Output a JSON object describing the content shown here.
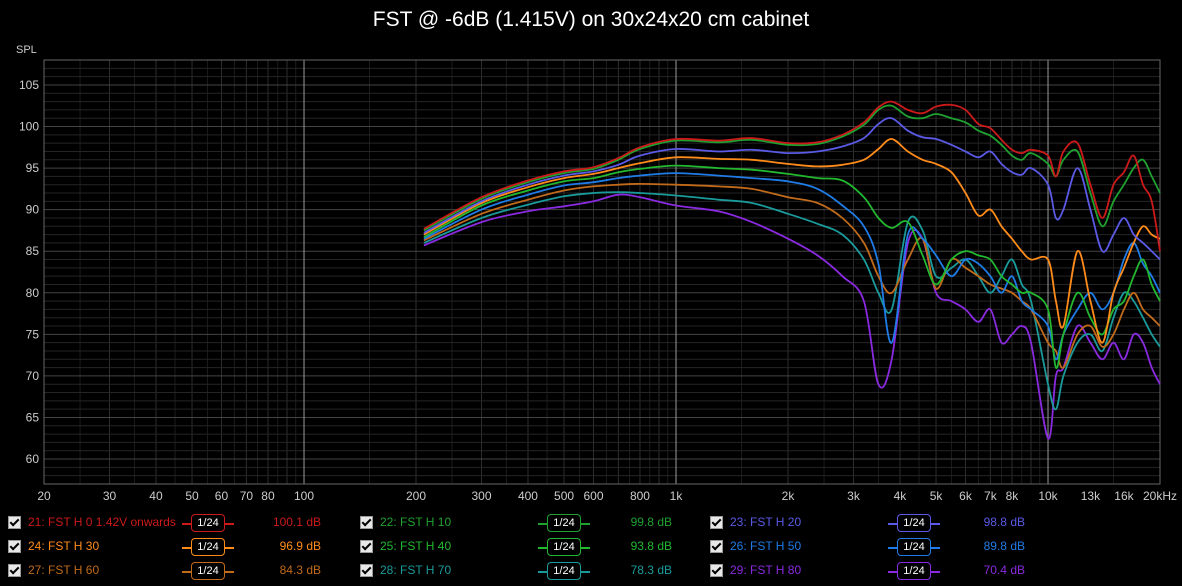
{
  "title": "FST @ -6dB (1.415V) on 30x24x20 cm cabinet",
  "smoothing_label": "1/24",
  "chart_data": {
    "type": "line",
    "title": "FST @ -6dB (1.415V) on 30x24x20 cm cabinet",
    "xlabel": "",
    "ylabel": "SPL",
    "x_scale": "log",
    "xlim": [
      20,
      20000
    ],
    "ylim": [
      57,
      108
    ],
    "grid": true,
    "x_ticks": [
      {
        "v": 20,
        "label": "20"
      },
      {
        "v": 30,
        "label": "30"
      },
      {
        "v": 40,
        "label": "40"
      },
      {
        "v": 50,
        "label": "50"
      },
      {
        "v": 60,
        "label": "60"
      },
      {
        "v": 70,
        "label": "70"
      },
      {
        "v": 80,
        "label": "80"
      },
      {
        "v": 100,
        "label": "100"
      },
      {
        "v": 200,
        "label": "200"
      },
      {
        "v": 300,
        "label": "300"
      },
      {
        "v": 400,
        "label": "400"
      },
      {
        "v": 500,
        "label": "500"
      },
      {
        "v": 600,
        "label": "600"
      },
      {
        "v": 800,
        "label": "800"
      },
      {
        "v": 1000,
        "label": "1k"
      },
      {
        "v": 2000,
        "label": "2k"
      },
      {
        "v": 3000,
        "label": "3k"
      },
      {
        "v": 4000,
        "label": "4k"
      },
      {
        "v": 5000,
        "label": "5k"
      },
      {
        "v": 6000,
        "label": "6k"
      },
      {
        "v": 7000,
        "label": "7k"
      },
      {
        "v": 8000,
        "label": "8k"
      },
      {
        "v": 10000,
        "label": "10k"
      },
      {
        "v": 13000,
        "label": "13k"
      },
      {
        "v": 16000,
        "label": "16k"
      },
      {
        "v": 20000,
        "label": "20kHz"
      }
    ],
    "y_ticks": [
      60,
      65,
      70,
      75,
      80,
      85,
      90,
      95,
      100,
      105
    ],
    "legend_placement": "bottom",
    "x": [
      210,
      300,
      400,
      500,
      600,
      700,
      800,
      1000,
      1300,
      1600,
      2000,
      2400,
      2800,
      3200,
      3500,
      3800,
      4200,
      4600,
      5000,
      5500,
      6000,
      6500,
      7000,
      7500,
      8000,
      8500,
      9000,
      10000,
      10500,
      11000,
      12000,
      13000,
      14000,
      15000,
      16000,
      17000,
      18000,
      19000,
      20000
    ],
    "series": [
      {
        "name": "21: FST H 0 1.42V onwards",
        "color": "#cc1a1a",
        "value_label": "100.1 dB",
        "values": [
          87.7,
          91.5,
          93.5,
          94.6,
          95.1,
          96.2,
          97.5,
          98.5,
          98.3,
          98.6,
          98.0,
          98.1,
          99.0,
          100.5,
          102.3,
          103.0,
          102.0,
          101.6,
          102.4,
          102.6,
          102.0,
          100.3,
          99.8,
          98.4,
          97.2,
          96.8,
          97.2,
          96.5,
          94.0,
          97.0,
          98.0,
          93.0,
          89.0,
          93.0,
          94.5,
          96.5,
          93.0,
          91.0,
          85.0
        ]
      },
      {
        "name": "22: FST H 10",
        "color": "#1fa12f",
        "value_label": "99.8 dB",
        "values": [
          87.5,
          91.3,
          93.3,
          94.4,
          94.9,
          96.0,
          97.3,
          98.3,
          98.1,
          98.4,
          97.8,
          97.9,
          98.8,
          100.2,
          102.0,
          102.5,
          101.2,
          101.0,
          101.5,
          101.0,
          100.5,
          99.5,
          98.9,
          97.8,
          96.5,
          96.0,
          96.8,
          95.5,
          94.0,
          96.0,
          97.0,
          92.0,
          88.0,
          91.0,
          93.0,
          95.0,
          96.0,
          94.0,
          92.0
        ]
      },
      {
        "name": "23: FST H 20",
        "color": "#5a5ae6",
        "value_label": "98.8 dB",
        "values": [
          87.2,
          91.0,
          93.0,
          94.1,
          94.6,
          95.4,
          96.5,
          97.3,
          97.0,
          97.2,
          96.8,
          97.0,
          97.6,
          98.6,
          100.3,
          101.0,
          99.5,
          98.7,
          98.5,
          97.8,
          97.0,
          96.3,
          97.0,
          95.5,
          94.5,
          94.2,
          95.0,
          93.0,
          89.0,
          90.0,
          95.0,
          90.0,
          85.0,
          87.0,
          89.0,
          87.0,
          86.0,
          85.0,
          84.0
        ]
      },
      {
        "name": "24: FST H 30",
        "color": "#ff8c1a",
        "value_label": "96.9 dB",
        "values": [
          87.0,
          90.8,
          92.7,
          93.8,
          94.3,
          95.0,
          95.6,
          96.3,
          96.1,
          96.0,
          95.5,
          95.2,
          95.4,
          96.0,
          97.3,
          98.5,
          97.0,
          96.0,
          95.5,
          94.5,
          92.0,
          89.3,
          90.0,
          88.0,
          86.5,
          85.0,
          84.0,
          84.0,
          79.0,
          76.0,
          85.0,
          79.0,
          74.0,
          80.0,
          83.0,
          86.0,
          88.0,
          87.0,
          86.5
        ]
      },
      {
        "name": "25: FST H 40",
        "color": "#22b82f",
        "value_label": "93.8 dB",
        "values": [
          86.7,
          90.5,
          92.3,
          93.4,
          93.8,
          94.5,
          94.9,
          95.3,
          95.0,
          94.8,
          94.3,
          93.8,
          93.5,
          91.5,
          89.0,
          87.8,
          88.5,
          84.5,
          81.0,
          84.0,
          85.0,
          84.5,
          84.0,
          82.0,
          81.0,
          80.0,
          80.0,
          78.0,
          71.0,
          75.0,
          80.0,
          77.0,
          75.0,
          78.0,
          79.0,
          82.0,
          84.0,
          81.0,
          79.0
        ]
      },
      {
        "name": "26: FST H 50",
        "color": "#1f7be6",
        "value_label": "89.8 dB",
        "values": [
          86.5,
          90.0,
          91.8,
          92.9,
          93.3,
          93.8,
          94.1,
          94.4,
          94.1,
          93.8,
          93.4,
          92.5,
          90.5,
          88.0,
          83.5,
          74.0,
          87.0,
          86.5,
          84.5,
          82.0,
          84.0,
          83.5,
          82.0,
          80.0,
          82.0,
          79.0,
          78.0,
          76.0,
          72.0,
          75.0,
          78.0,
          80.0,
          78.0,
          80.0,
          84.0,
          86.0,
          83.5,
          82.0,
          80.0
        ]
      },
      {
        "name": "27: FST H 60",
        "color": "#c06a1a",
        "value_label": "84.3 dB",
        "values": [
          86.3,
          89.5,
          91.2,
          92.3,
          92.8,
          93.0,
          93.1,
          93.0,
          92.8,
          92.5,
          91.5,
          90.8,
          89.0,
          86.0,
          82.0,
          80.0,
          84.0,
          86.5,
          80.5,
          84.0,
          83.0,
          82.0,
          81.0,
          80.5,
          80.0,
          79.0,
          78.0,
          74.0,
          73.0,
          71.0,
          75.0,
          76.0,
          73.5,
          75.0,
          78.0,
          80.0,
          78.0,
          77.0,
          76.0
        ]
      },
      {
        "name": "28: FST H 70",
        "color": "#1a9a9a",
        "value_label": "78.3 dB",
        "values": [
          86.0,
          89.0,
          90.6,
          91.6,
          92.0,
          92.1,
          92.0,
          91.7,
          91.2,
          90.8,
          89.5,
          88.3,
          87.0,
          84.0,
          80.0,
          78.0,
          88.5,
          87.5,
          82.0,
          83.0,
          84.0,
          82.0,
          80.0,
          82.0,
          84.0,
          81.0,
          79.0,
          69.0,
          66.0,
          70.0,
          74.0,
          75.0,
          73.0,
          77.0,
          80.0,
          79.0,
          77.0,
          75.0,
          73.5
        ]
      },
      {
        "name": "29: FST H 80",
        "color": "#8a2ae0",
        "value_label": "70.4 dB",
        "values": [
          85.7,
          88.5,
          89.8,
          90.4,
          91.0,
          91.8,
          91.5,
          90.5,
          89.8,
          88.5,
          86.5,
          84.5,
          82.0,
          79.0,
          69.0,
          72.0,
          86.0,
          86.5,
          80.0,
          79.0,
          78.0,
          76.5,
          78.0,
          74.0,
          75.0,
          76.0,
          74.0,
          62.5,
          70.0,
          71.0,
          76.0,
          74.0,
          72.0,
          74.0,
          72.0,
          75.0,
          74.0,
          71.0,
          69.0
        ]
      }
    ]
  }
}
